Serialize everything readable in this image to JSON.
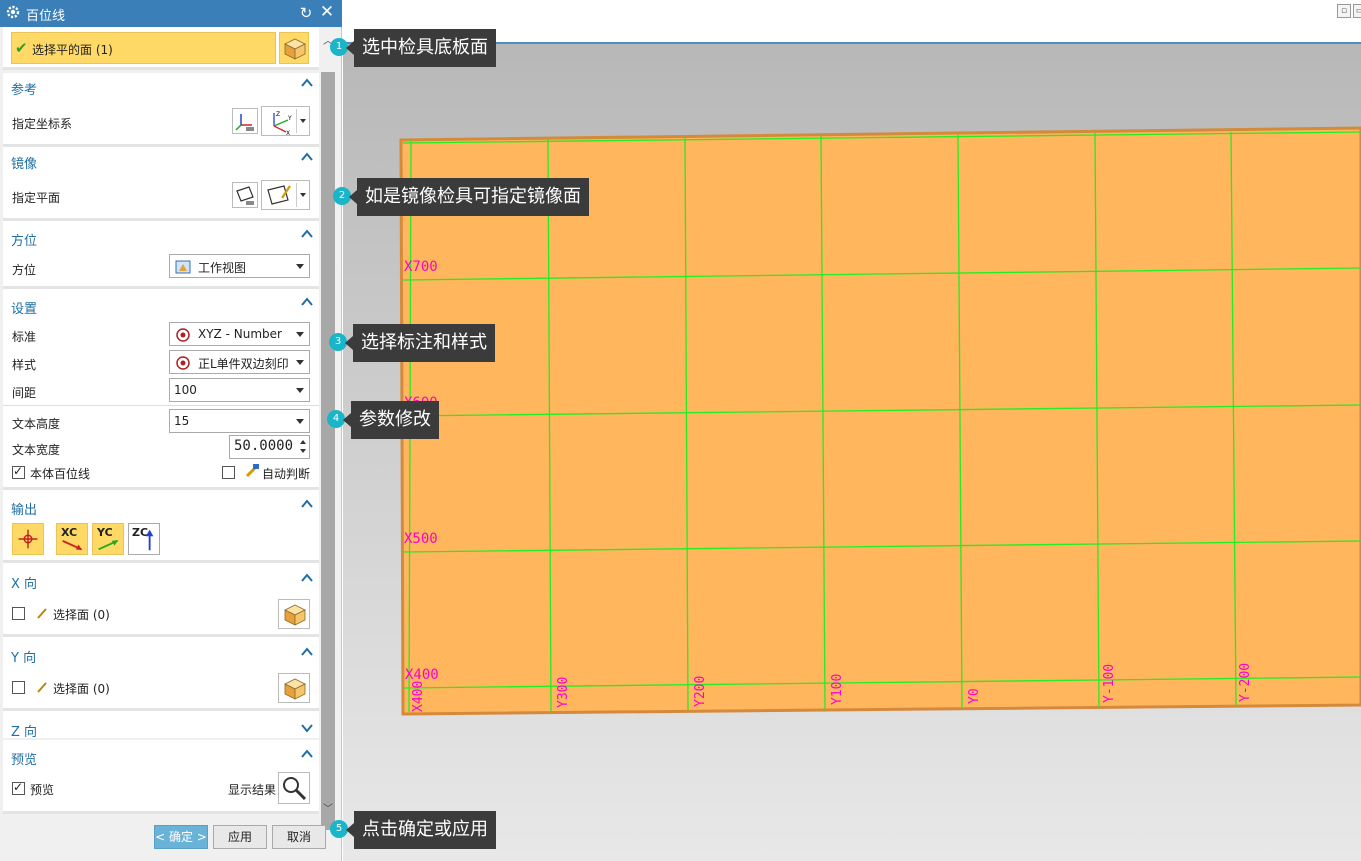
{
  "dialog": {
    "title": "百位线",
    "selection": {
      "label": "选择平的面 (1)"
    },
    "sections": {
      "reference": {
        "title": "参考",
        "row_label": "指定坐标系"
      },
      "mirror": {
        "title": "镜像",
        "row_label": "指定平面"
      },
      "orientation": {
        "title": "方位",
        "row_label": "方位",
        "value": "工作视图"
      },
      "settings": {
        "title": "设置",
        "standard_label": "标准",
        "standard_value": "XYZ - Number",
        "style_label": "样式",
        "style_value": "正L单件双边刻印",
        "spacing_label": "间距",
        "spacing_value": "100",
        "text_height_label": "文本高度",
        "text_height_value": "15",
        "text_width_label": "文本宽度",
        "text_width_value": "50.0000",
        "body_lines_label": "本体百位线",
        "body_lines_checked": true,
        "auto_label": "自动判断",
        "auto_checked": false
      },
      "output": {
        "title": "输出",
        "xc": "XC",
        "yc": "YC",
        "zc": "ZC"
      },
      "x_dir": {
        "title": "X 向",
        "select_label": "选择面 (0)"
      },
      "y_dir": {
        "title": "Y 向",
        "select_label": "选择面 (0)"
      },
      "z_dir": {
        "title": "Z 向"
      },
      "preview": {
        "title": "预览",
        "preview_label": "预览",
        "preview_checked": true,
        "show_result_label": "显示结果"
      }
    },
    "buttons": {
      "ok": "< 确定 >",
      "apply": "应用",
      "cancel": "取消"
    }
  },
  "callouts": [
    {
      "num": "1",
      "text": "选中检具底板面"
    },
    {
      "num": "2",
      "text": "如是镜像检具可指定镜像面"
    },
    {
      "num": "3",
      "text": "选择标注和样式"
    },
    {
      "num": "4",
      "text": "参数修改"
    },
    {
      "num": "5",
      "text": "点击确定或应用"
    }
  ],
  "grid_labels": {
    "x": [
      "X700",
      "X600",
      "X500",
      "X400"
    ],
    "y": [
      "X400",
      "Y300",
      "Y200",
      "Y100",
      "Y0",
      "Y-100",
      "Y-200"
    ]
  },
  "colors": {
    "title_bar": "#3a7fb8",
    "section_title": "#1f6fa3",
    "selected_row": "#ffd966",
    "plate": "#ffb65c",
    "grid_line": "#22ee22",
    "grid_label": "#ff00cc",
    "callout_bg": "#3b3b3b",
    "callout_num": "#1ab5c8"
  }
}
